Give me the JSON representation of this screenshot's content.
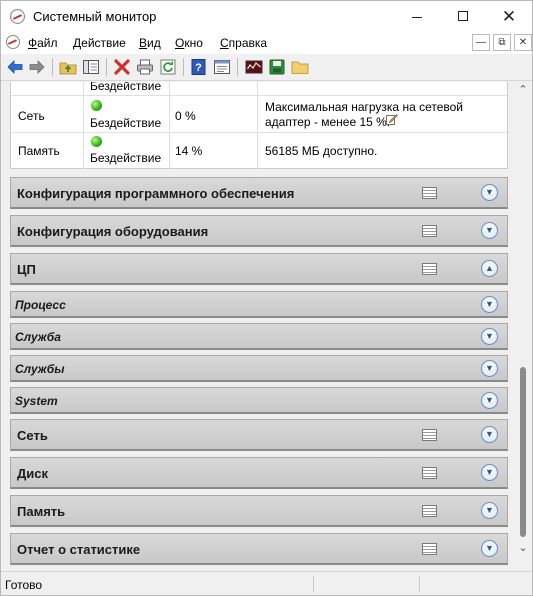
{
  "window": {
    "title": "Системный монитор",
    "controls": {
      "minimize": "—",
      "maximize": "☐",
      "close": "✕"
    }
  },
  "menu": {
    "items": [
      {
        "label_u": "Ф",
        "label_rest": "айл"
      },
      {
        "label_u": "Д",
        "label_rest": "ействие"
      },
      {
        "label_u": "В",
        "label_rest": "ид"
      },
      {
        "label_u": "О",
        "label_rest": "кно"
      },
      {
        "label_u": "С",
        "label_rest": "правка"
      }
    ],
    "mdi_controls": [
      "—",
      "⧉",
      "✕"
    ]
  },
  "toolbar": {
    "icons": [
      "back-arrow-icon",
      "forward-arrow-icon",
      "up-folder-icon",
      "show-hide-tree-icon",
      "delete-icon",
      "print-icon",
      "refresh-icon",
      "help-icon",
      "properties-icon",
      "report-icon",
      "save-icon",
      "folder-icon"
    ]
  },
  "resources": {
    "top_row": {
      "status": "Бездействие",
      "note_fragment": ""
    },
    "rows": [
      {
        "name": "Сеть",
        "status": "Бездействие",
        "value": "0 %",
        "desc_line1": "Максимальная нагрузка на сетевой",
        "desc_line2": "адаптер - менее 15 %."
      },
      {
        "name": "Память",
        "status": "Бездействие",
        "value": "14 %",
        "desc_line1": "56185 МБ доступно.",
        "desc_line2": ""
      }
    ]
  },
  "sections": [
    {
      "label": "Конфигурация программного обеспечения",
      "style": "large",
      "has_icon": true,
      "expanded": false
    },
    {
      "label": "Конфигурация оборудования",
      "style": "large",
      "has_icon": true,
      "expanded": false
    },
    {
      "label": "ЦП",
      "style": "large",
      "has_icon": true,
      "expanded": true
    },
    {
      "label": "Процесс",
      "style": "small",
      "has_icon": false,
      "expanded": false
    },
    {
      "label": "Служба",
      "style": "small",
      "has_icon": false,
      "expanded": false
    },
    {
      "label": "Службы",
      "style": "small",
      "has_icon": false,
      "expanded": false
    },
    {
      "label": "System",
      "style": "small",
      "has_icon": false,
      "expanded": false
    },
    {
      "label": "Сеть",
      "style": "large",
      "has_icon": true,
      "expanded": false
    },
    {
      "label": "Диск",
      "style": "large",
      "has_icon": true,
      "expanded": false
    },
    {
      "label": "Память",
      "style": "large",
      "has_icon": true,
      "expanded": false
    },
    {
      "label": "Отчет о статистике",
      "style": "large",
      "has_icon": true,
      "expanded": false
    }
  ],
  "statusbar": {
    "text": "Готово"
  },
  "colors": {
    "section_bg": "#cfcfcf",
    "status_green": "#37b61e",
    "chevron_blue": "#2f5b96"
  }
}
